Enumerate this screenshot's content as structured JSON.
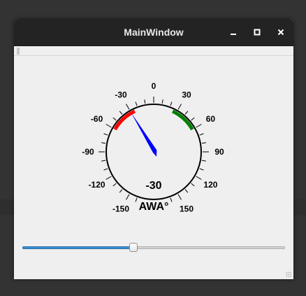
{
  "window": {
    "title": "MainWindow"
  },
  "gauge": {
    "value": -30,
    "value_label": "-30",
    "unit_label": "AWA°",
    "min": -180,
    "max": 180,
    "scale_labels": [
      "0",
      "30",
      "60",
      "90",
      "120",
      "150",
      "-150",
      "-120",
      "-90",
      "-60",
      "-30"
    ],
    "scale_values": [
      0,
      30,
      60,
      90,
      120,
      150,
      -150,
      -120,
      -90,
      -60,
      -30
    ],
    "red_zone": [
      -60,
      -30
    ],
    "green_zone": [
      30,
      60
    ],
    "colors": {
      "port_zone": "#ff0000",
      "starboard_zone": "#008000",
      "needle": "#0000ff",
      "dial_border": "#000000"
    }
  },
  "slider": {
    "value_fraction": 0.42,
    "fill_color": "#3a8fd5"
  }
}
